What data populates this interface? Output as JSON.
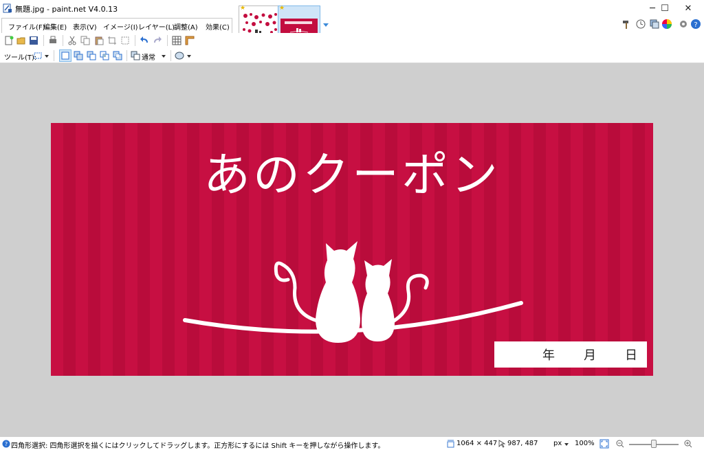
{
  "window": {
    "title": "無題.jpg - paint.net V4.0.13",
    "minimize": "─",
    "maximize": "☐",
    "close": "✕"
  },
  "menu": {
    "items": [
      "ファイル(F)",
      "編集(E)",
      "表示(V)",
      "イメージ(I)",
      "レイヤー(L)",
      "調整(A)",
      "効果(C)"
    ]
  },
  "toolbar2": {
    "tool_label": "ツール(T):",
    "blend_mode": "通常"
  },
  "canvas_image": {
    "title": "あのクーポン",
    "date_text": "年　　月　　日"
  },
  "status": {
    "hint": "四角形選択: 四角形選択を描くにはクリックしてドラッグします。正方形にするには Shift キーを押しながら操作します。",
    "image_size": "1064 × 447",
    "cursor_pos": "987, 487",
    "unit": "px",
    "zoom": "100%"
  },
  "colors": {
    "accent": "#c30d3f",
    "workspace": "#cfcfcf"
  }
}
